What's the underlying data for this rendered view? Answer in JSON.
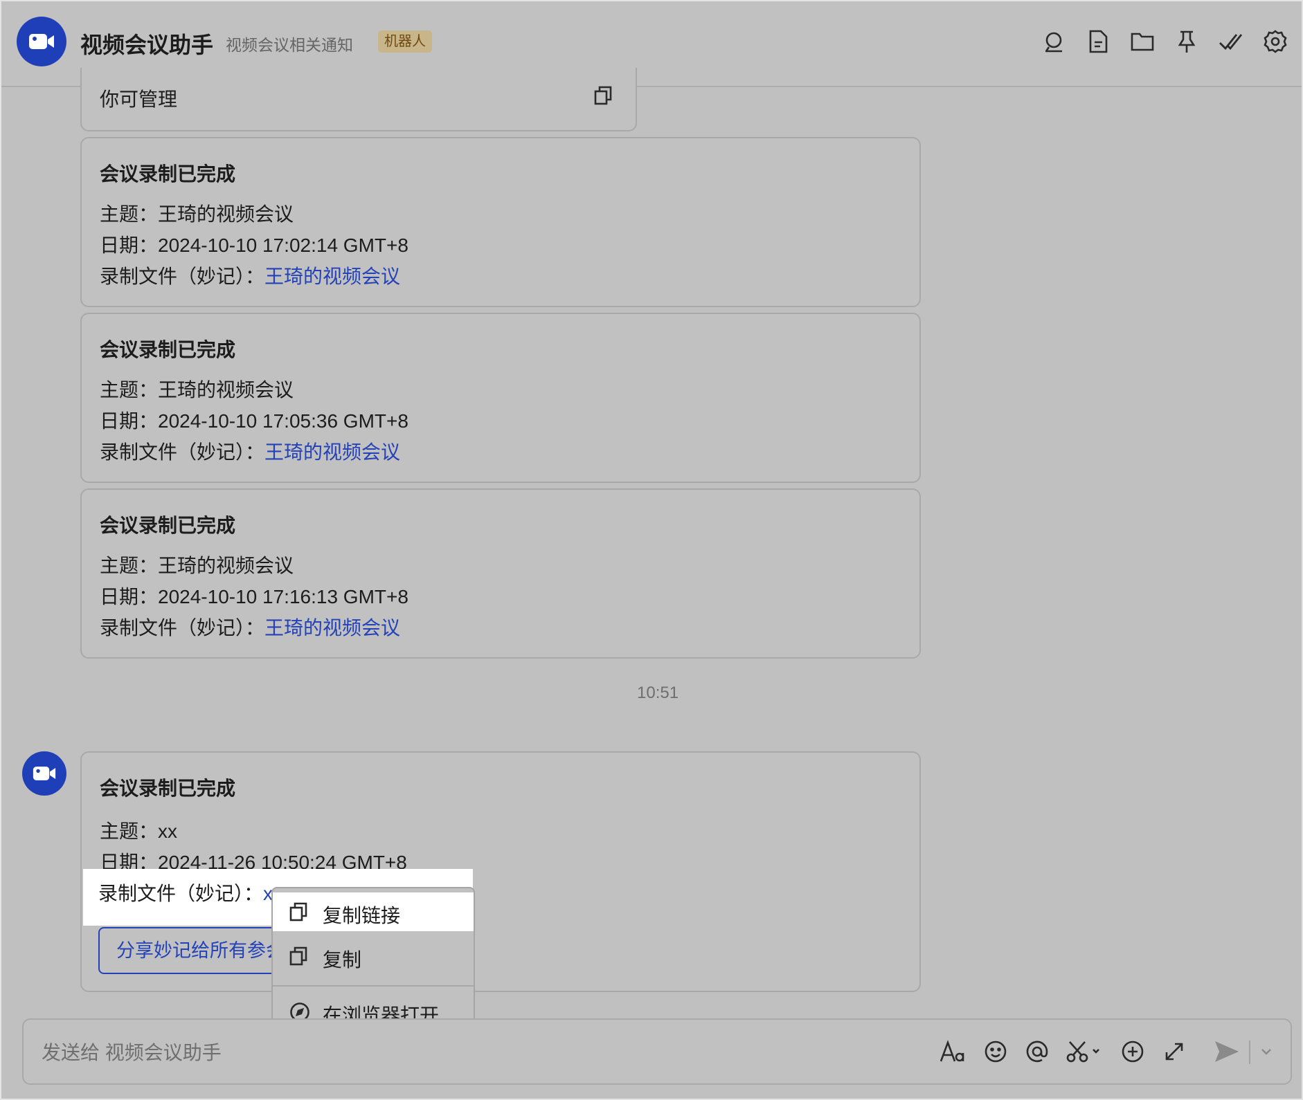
{
  "header": {
    "title": "视频会议助手",
    "subtitle": "视频会议相关通知",
    "tag": "机器人",
    "icons": [
      "search-icon",
      "document-icon",
      "folder-icon",
      "pin-icon",
      "double-check-icon",
      "gear-icon"
    ]
  },
  "partial_card": {
    "text": "你可管理"
  },
  "cards": [
    {
      "title": "会议录制已完成",
      "topic_label": "主题：",
      "topic": "王琦的视频会议",
      "date_label": "日期：",
      "date": "2024-10-10 17:02:14 GMT+8",
      "file_label": "录制文件（妙记）：",
      "file_link": "王琦的视频会议"
    },
    {
      "title": "会议录制已完成",
      "topic_label": "主题：",
      "topic": "王琦的视频会议",
      "date_label": "日期：",
      "date": "2024-10-10 17:05:36 GMT+8",
      "file_label": "录制文件（妙记）：",
      "file_link": "王琦的视频会议"
    },
    {
      "title": "会议录制已完成",
      "topic_label": "主题：",
      "topic": "王琦的视频会议",
      "date_label": "日期：",
      "date": "2024-10-10 17:16:13 GMT+8",
      "file_label": "录制文件（妙记）：",
      "file_link": "王琦的视频会议"
    }
  ],
  "time_separator": "10:51",
  "last_card": {
    "title": "会议录制已完成",
    "topic_label": "主题：",
    "topic": "xx",
    "date_label": "日期：",
    "date": "2024-11-26 10:50:24 GMT+8",
    "file_label": "录制文件（妙记）：",
    "file_link": "xx",
    "share_button": "分享妙记给所有参会人"
  },
  "context_menu": {
    "items": [
      {
        "label": "复制链接",
        "icon": "copy-icon"
      },
      {
        "label": "复制",
        "icon": "copy-icon"
      },
      {
        "label": "在浏览器打开",
        "icon": "compass-icon"
      }
    ]
  },
  "composer": {
    "placeholder": "发送给 视频会议助手",
    "icons": [
      "font-format-icon",
      "emoji-icon",
      "mention-icon",
      "scissors-icon",
      "add-icon",
      "expand-icon",
      "send-icon",
      "chevron-down-icon"
    ]
  },
  "colors": {
    "brand_blue": "#1f3fb8",
    "link_blue": "#2342b8",
    "tag_bg": "#c9b58a"
  }
}
